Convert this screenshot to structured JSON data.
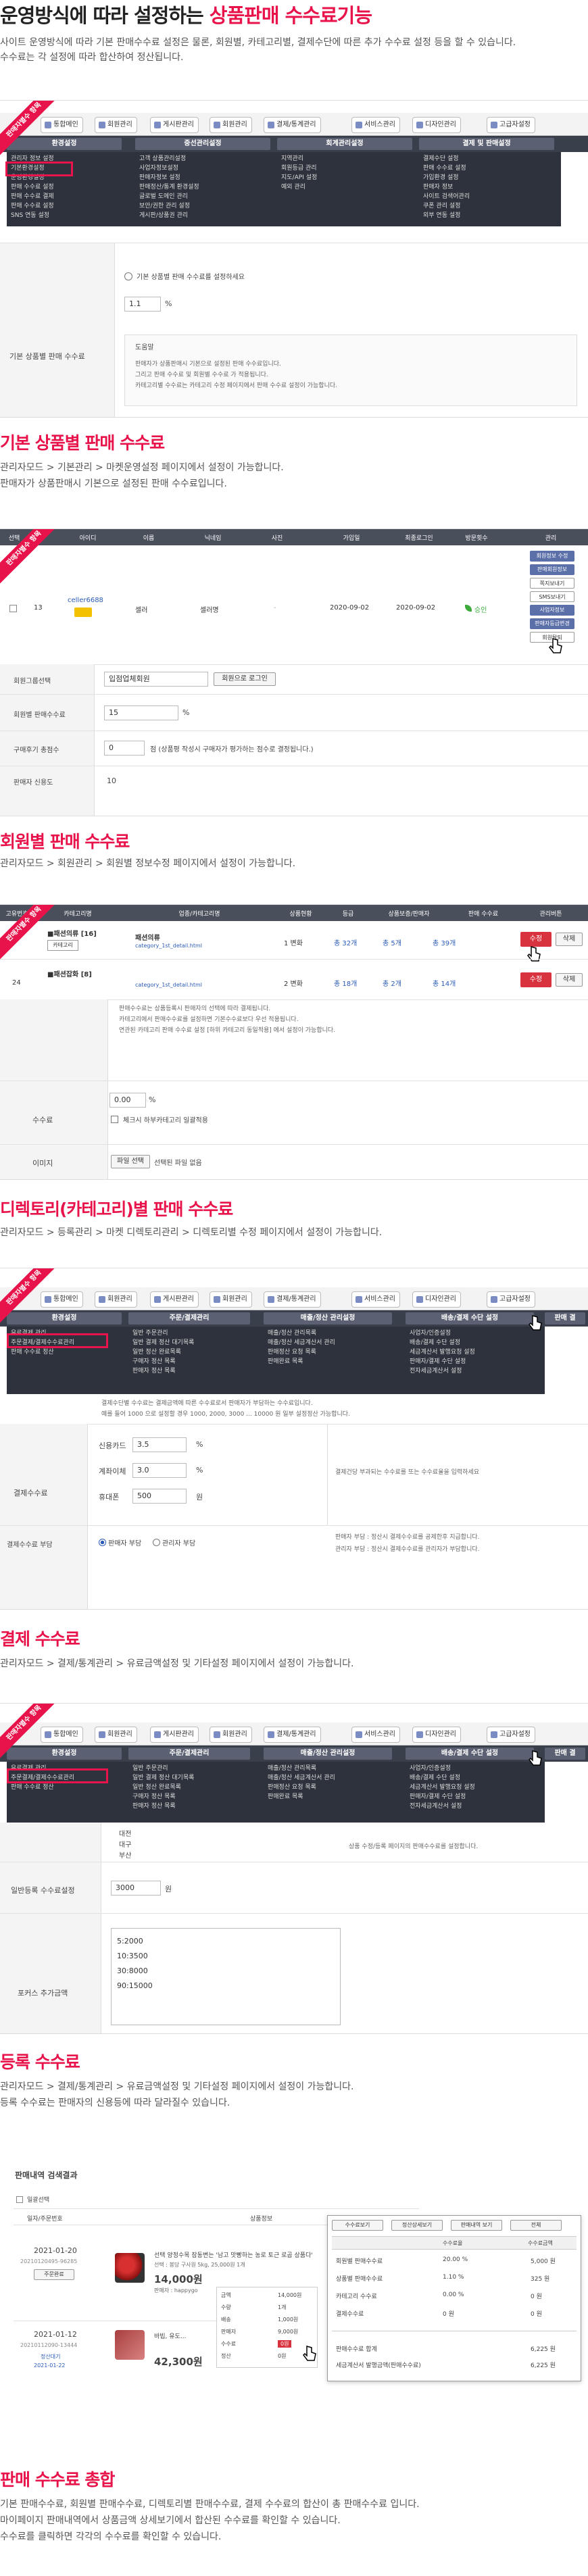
{
  "header": {
    "title_prefix": "운영방식에 따라 설정하는 ",
    "title_highlight": "상품판매 수수료기능",
    "desc_line1": "사이트 운영방식에 따라 기본 판매수수료 설정은 물론, 회원별, 카테고리별, 결제수단에 따른 추가 수수료 설정 등을 할 수 있습니다.",
    "desc_line2": "수수료는 각 설정에 따라 합산하여 정산됩니다."
  },
  "ribbon": "판매자별수 항목",
  "tabs": [
    "통합메인",
    "회원관리",
    "게시판관리",
    "회원관리",
    "결제/통계관리",
    "서비스관리",
    "디자인관리",
    "고급자설정"
  ],
  "menus1": [
    "환경설정",
    "중선관리설정",
    "회계관리설정",
    "결제 및 판매설정"
  ],
  "shot1": {
    "sub_col1": [
      "관리자 정보 설정",
      "기본환경설정",
      "운영환경설정",
      "판매 수수료 설정",
      "판매 수수료 결제",
      "판매 수수료 설정",
      "SNS 연동 설정"
    ],
    "sub_col2": [
      "고객 상품관리설정",
      "사업자정보설정",
      "판매자정보 설정",
      "판매정산/통계 환경설정",
      "글로벌 도메인 관리",
      "보안/권한 관리 설정",
      "게시판/상품권 관리"
    ],
    "sub_col3": [
      "지역관리",
      "회원등급 관리",
      "지도/API 설정",
      "예외 관리"
    ],
    "sub_col4": [
      "결제수단 설정",
      "판매 수수료 설정",
      "가입환경 설정",
      "판매자 정보",
      "사이트 검색어관리",
      "쿠폰 관리 설정",
      "외부 연동 설정"
    ],
    "field_label": "기본 상품별 판매 수수료",
    "radio_text": "기본 상품별 판매 수수료를 설정하세요",
    "rate_value": "1.1",
    "rate_unit": "%",
    "help_title": "도움말",
    "help1": "판매자가 상품판매시 기본으로 설정된 판매 수수료입니다.",
    "help2": "그리고 판매 수수료 및 회원별 수수료 가 적용됩니다.",
    "help3": "카테고리별 수수료는 카테고리 수정 페이지에서 판매 수수료 설정이 가능합니다."
  },
  "section1": {
    "title": "기본 상품별 판매 수수료",
    "desc1": "관리자모드 > 기본관리 > 마켓운영설정 페이지에서 설정이 가능합니다.",
    "desc2": "판매자가 상품판매시 기본으로 설정된 판매 수수료입니다."
  },
  "shot2": {
    "headers": [
      "선택",
      "번호",
      "아이디",
      "이름",
      "닉네임",
      "사진",
      "가입일",
      "최종로그인",
      "방문횟수",
      "관리"
    ],
    "row_no": "13",
    "row_id": "celler6688",
    "row_name": "셀러",
    "row_nick": "셀러명",
    "row_photo": "-",
    "row_join": "2020-09-02",
    "row_login": "2020-09-02",
    "row_status": "승인",
    "side_btns": [
      "회원정보 수정",
      "판매회원정보",
      "쪽지보내기",
      "SMS보내기",
      "사업자정보",
      "판매자등급변경",
      "회원탈퇴"
    ],
    "f1_label": "회원그룹선택",
    "f1_value": "입점업체회원",
    "f1_btn": "회원으로 로그인",
    "f2_label": "회원별 판매수수료",
    "f2_value": "15",
    "f2_unit": "%",
    "f3_label": "구매후기 총점수",
    "f3_value": "0",
    "f3_note": "점 (상품평 작성시 구매자가 평가하는 점수로 결정됩니다.)",
    "f4_label": "판매자 신용도",
    "f4_value": "10"
  },
  "section2": {
    "title": "회원별 판매 수수료",
    "desc1": "관리자모드 > 회원관리 > 회원별 정보수정 페이지에서 설정이 가능합니다."
  },
  "shot3": {
    "headers": [
      "고유번호",
      "카테고리명",
      "업종/카테고리명",
      "상품현황",
      "등급",
      "상품보증/판매자",
      "판매 수수료",
      "관리버튼"
    ],
    "row1_name": "■패션의류 [16]",
    "row1_tag": "카테고리",
    "row1_sub": "패션의류",
    "row1_count": "1 변화",
    "row1_grade": "총 32개",
    "row1_a": "총 5개",
    "row1_b": "총 39개",
    "row1_edit": "수정",
    "row1_del": "삭제",
    "row2_no": "24",
    "row2_name": "■패션잡화 [8]",
    "row2_count": "2 변화",
    "row2_grade": "총 18개",
    "row2_a": "총 2개",
    "row2_b": "총 14개",
    "cat_link": "category_1st_detail.html",
    "note1": "판매수수료는 상품등록시 판매자의 선택에 따라 결제됩니다.",
    "note2": "카테고리에서 판매수수료를 설정하면 기본수수료보다 우선 적용됩니다.",
    "note3": "연관된 카테고리 판매 수수료 설정 [하위 카테고리 동일적용] 에서 설정이 가능합니다.",
    "f1_label": "수수료",
    "f1_value": "0.00",
    "f1_unit": "%",
    "f1_check": "체크시 하부카테고리 일괄적용",
    "f2_label": "이미지",
    "f2_btn": "파일 선택",
    "f2_text": "선택된 파일 없음"
  },
  "section3": {
    "title": "디렉토리(카테고리)별 판매 수수료",
    "desc1": "관리자모드 > 등록관리 > 마켓 디렉토리관리 > 디렉토리별 수정 페이지에서 설정이 가능합니다."
  },
  "menus4": [
    "환경설정",
    "주문/결제관리",
    "매출/정산 관리설정",
    "배송/결제 수단 설정",
    "판매 결"
  ],
  "shot4": {
    "sub_left": [
      "유료결제 관리",
      "주문결제/결제수수료관리",
      "판매 수수료 정산"
    ],
    "sub_col2": [
      "일반 주문관리",
      "일반 결제 정산 대기목록",
      "일반 정산 완료목록",
      "구매자 정산 목록",
      "판매자 정산 목록"
    ],
    "sub_col3": [
      "매출/정산 관리목록",
      "매출/정산 세금계산서 관리",
      "판매정산 요청 목록",
      "판매완료 목록"
    ],
    "sub_col4": [
      "사업자/인증설정",
      "배송/결제 수단 설정",
      "세금계산서 발행요청 설정",
      "판매자/결제 수단 설정",
      "전자세금계산서 설정"
    ],
    "help1": "결제수단별 수수료는 결제금액에 따른 수수료로서 판매자가 부담하는 수수료입니다.",
    "help2": "예를 들어 1000 으로 설정할 경우 1000, 2000, 3000 ... 10000 원 일부 설정정산 가능합니다.",
    "field_label": "결제수수료",
    "rows": [
      {
        "name": "신용카드",
        "value": "3.5",
        "unit": "%"
      },
      {
        "name": "계좌이체",
        "value": "3.0",
        "unit": "%"
      },
      {
        "name": "휴대폰",
        "value": "500",
        "unit": "원"
      }
    ],
    "right_text": "결제건당 부과되는 수수료를 또는 수수료율을 입력하세요",
    "burden_label": "결제수수료 부담",
    "burden_opt1": "판매자 부담",
    "burden_opt2": "관리자 부담",
    "burden_note1": "판매자 부담 : 정산시 결제수수료를 공제한후 지급합니다.",
    "burden_note2": "관리자 부담 : 정산시 결제수수료를 관리자가 부담합니다."
  },
  "section4": {
    "title": "결제 수수료",
    "desc1": "관리자모드 > 결제/통계관리 > 유료금액설정 및 기타설정 페이지에서 설정이 가능합니다."
  },
  "shot5": {
    "region_list": [
      "대전",
      "대구",
      "부산"
    ],
    "note": "상품 수정/등록 페이지의 판매수수료를 설정합니다.",
    "f1_label": "일반등록 수수료설정",
    "f1_value": "3000",
    "f1_unit": "원",
    "f2_label": "포커스 추가금액",
    "f2_values": [
      "5:2000",
      "10:3500",
      "30:8000",
      "90:15000"
    ]
  },
  "section5": {
    "title": "등록 수수료",
    "desc1": "관리자모드 > 결제/통계관리 > 유료금액설정 및 기타설정 페이지에서 설정이 가능합니다.",
    "desc2": "등록 수수료는 판매자의 신용등에 따라 달라질수 있습니다."
  },
  "shot6": {
    "title": "판매내역 검색결과",
    "toolbar": "일괄선택",
    "col_headers": [
      "일자/주문번호",
      "상품정보"
    ],
    "order1_date": "2021-01-20",
    "order1_no": "20210120495-96285",
    "order1_status": "주문완료",
    "order1_product": "선택 양정수목 잠동변는 '남고 맛빵하는 농로 토근 로곱 상품다'",
    "order1_sub": "선택 : 봉당 구사원 5kg, 25,000원 1개",
    "order1_price": "14,000원",
    "order1_seller": "판매자 : happygo",
    "order2_date": "2021-01-12",
    "order2_no": "20210112090-13444",
    "order2_status": "정산대기",
    "order2_date2": "2021-01-22",
    "order2_product": "바빕, 유도...",
    "order2_price": "42,300원",
    "mini_rows": [
      {
        "k": "금액",
        "v": "14,000원"
      },
      {
        "k": "수량",
        "v": "1개"
      },
      {
        "k": "배송",
        "v": "1,000원"
      },
      {
        "k": "판매자",
        "v": "9,000원"
      },
      {
        "k": "수수료",
        "v": "0원"
      },
      {
        "k": "정산",
        "v": "0원"
      }
    ],
    "popup_tabs": [
      "수수료보기",
      "정산상세보기",
      "판매내역 보기",
      "전체"
    ],
    "popup_head": [
      "",
      "수수료율",
      "수수료금액"
    ],
    "popup_rows": [
      {
        "k": "회원별 판매수수료",
        "r": "20.00 %",
        "v": "5,000 원"
      },
      {
        "k": "상품별 판매수수료",
        "r": "1.10 %",
        "v": "325 원"
      },
      {
        "k": "카테고리 수수료",
        "r": "0.00 %",
        "v": "0 원"
      },
      {
        "k": "결제수수료",
        "r": "0 원",
        "v": "0 원"
      }
    ],
    "popup_sum1_k": "판매수수료 합계",
    "popup_sum1_v": "6,225 원",
    "popup_sum2_k": "세금계산서 발행금액(판매수수료)",
    "popup_sum2_v": "6,225 원"
  },
  "section6": {
    "title": "판매 수수료 총합",
    "desc1": "기본 판매수수료, 회원별 판매수수료, 디렉토리별 판매수수료, 결제 수수료의 합산이 총 판매수수료 입니다.",
    "desc2": "마이페이지 판매내역에서 상품금액 상세보기에서 합산된 수수료를 확인할 수 있습니다.",
    "desc3": "수수료를 클릭하면 각각의 수수료를 확인할 수 있습니다."
  }
}
